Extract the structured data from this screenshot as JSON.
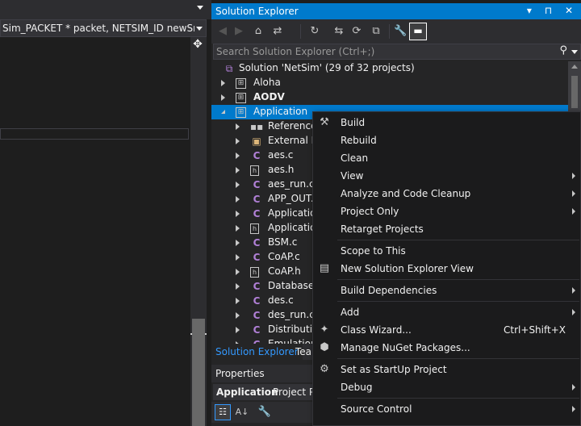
{
  "editor": {
    "nav_text": "Sim_PACKET * packet, NETSIM_ID newSrc, dou"
  },
  "solution_explorer": {
    "title": "Solution Explorer",
    "title_buttons": "▾ ⊓ ✕",
    "search_placeholder": "Search Solution Explorer (Ctrl+;)",
    "tree": [
      {
        "label": "Solution 'NetSim' (29 of 32 projects)",
        "icon": "solution-icon",
        "level": 0,
        "expander": "none"
      },
      {
        "label": "Aloha",
        "icon": "project-icon",
        "level": 1,
        "expander": "collapsed"
      },
      {
        "label": "AODV",
        "icon": "project-icon",
        "level": 1,
        "expander": "collapsed",
        "bold": true
      },
      {
        "label": "Application",
        "icon": "project-icon",
        "level": 1,
        "expander": "expanded",
        "selected": true
      },
      {
        "label": "References",
        "icon": "references-icon",
        "level": 2,
        "expander": "collapsed"
      },
      {
        "label": "External De",
        "icon": "external-deps-icon",
        "level": 2,
        "expander": "collapsed"
      },
      {
        "label": "aes.c",
        "icon": "c-file-icon",
        "level": 2,
        "expander": "collapsed"
      },
      {
        "label": "aes.h",
        "icon": "h-file-icon",
        "level": 2,
        "expander": "collapsed"
      },
      {
        "label": "aes_run.c",
        "icon": "c-file-icon",
        "level": 2,
        "expander": "collapsed"
      },
      {
        "label": "APP_OUT.c",
        "icon": "c-file-icon",
        "level": 2,
        "expander": "collapsed"
      },
      {
        "label": "Applicatio",
        "icon": "c-file-icon",
        "level": 2,
        "expander": "collapsed"
      },
      {
        "label": "Applicatio",
        "icon": "h-file-icon",
        "level": 2,
        "expander": "collapsed"
      },
      {
        "label": "BSM.c",
        "icon": "c-file-icon",
        "level": 2,
        "expander": "collapsed"
      },
      {
        "label": "CoAP.c",
        "icon": "c-file-icon",
        "level": 2,
        "expander": "collapsed"
      },
      {
        "label": "CoAP.h",
        "icon": "h-file-icon",
        "level": 2,
        "expander": "collapsed"
      },
      {
        "label": "Database_I",
        "icon": "c-file-icon",
        "level": 2,
        "expander": "collapsed"
      },
      {
        "label": "des.c",
        "icon": "c-file-icon",
        "level": 2,
        "expander": "collapsed"
      },
      {
        "label": "des_run.c",
        "icon": "c-file-icon",
        "level": 2,
        "expander": "collapsed"
      },
      {
        "label": "Distributio",
        "icon": "c-file-icon",
        "level": 2,
        "expander": "collapsed"
      },
      {
        "label": "Emulation",
        "icon": "c-file-icon",
        "level": 2,
        "expander": "collapsed"
      }
    ],
    "tabs": [
      "Solution Explorer",
      "Tea"
    ]
  },
  "properties": {
    "title": "Properties",
    "object_name": "Application",
    "object_kind": "Project Pr"
  },
  "context_menu": {
    "items": [
      {
        "label": "Build",
        "icon": "build-icon",
        "shortcut": "",
        "submenu": false
      },
      {
        "label": "Rebuild",
        "icon": "",
        "shortcut": "",
        "submenu": false
      },
      {
        "label": "Clean",
        "icon": "",
        "shortcut": "",
        "submenu": false
      },
      {
        "label": "View",
        "icon": "",
        "shortcut": "",
        "submenu": true
      },
      {
        "label": "Analyze and Code Cleanup",
        "icon": "",
        "shortcut": "",
        "submenu": true
      },
      {
        "label": "Project Only",
        "icon": "",
        "shortcut": "",
        "submenu": true
      },
      {
        "label": "Retarget Projects",
        "icon": "",
        "shortcut": "",
        "submenu": false
      },
      {
        "label": "Scope to This",
        "icon": "",
        "shortcut": "",
        "submenu": false,
        "sep_before": true
      },
      {
        "label": "New Solution Explorer View",
        "icon": "new-view-icon",
        "shortcut": "",
        "submenu": false
      },
      {
        "label": "Build Dependencies",
        "icon": "",
        "shortcut": "",
        "submenu": true,
        "sep_before": true
      },
      {
        "label": "Add",
        "icon": "",
        "shortcut": "",
        "submenu": true,
        "sep_before": true
      },
      {
        "label": "Class Wizard...",
        "icon": "class-wizard-icon",
        "shortcut": "Ctrl+Shift+X",
        "submenu": false
      },
      {
        "label": "Manage NuGet Packages...",
        "icon": "nuget-icon",
        "shortcut": "",
        "submenu": false
      },
      {
        "label": "Set as StartUp Project",
        "icon": "gear-icon",
        "shortcut": "",
        "submenu": false,
        "sep_before": true
      },
      {
        "label": "Debug",
        "icon": "",
        "shortcut": "",
        "submenu": true
      },
      {
        "label": "Source Control",
        "icon": "",
        "shortcut": "",
        "submenu": true,
        "sep_before": true
      }
    ]
  },
  "colors": {
    "accent": "#007acc",
    "background": "#1e1e1e",
    "panel": "#252526",
    "menu": "#1b1b1c",
    "c_file": "#b180d7"
  }
}
